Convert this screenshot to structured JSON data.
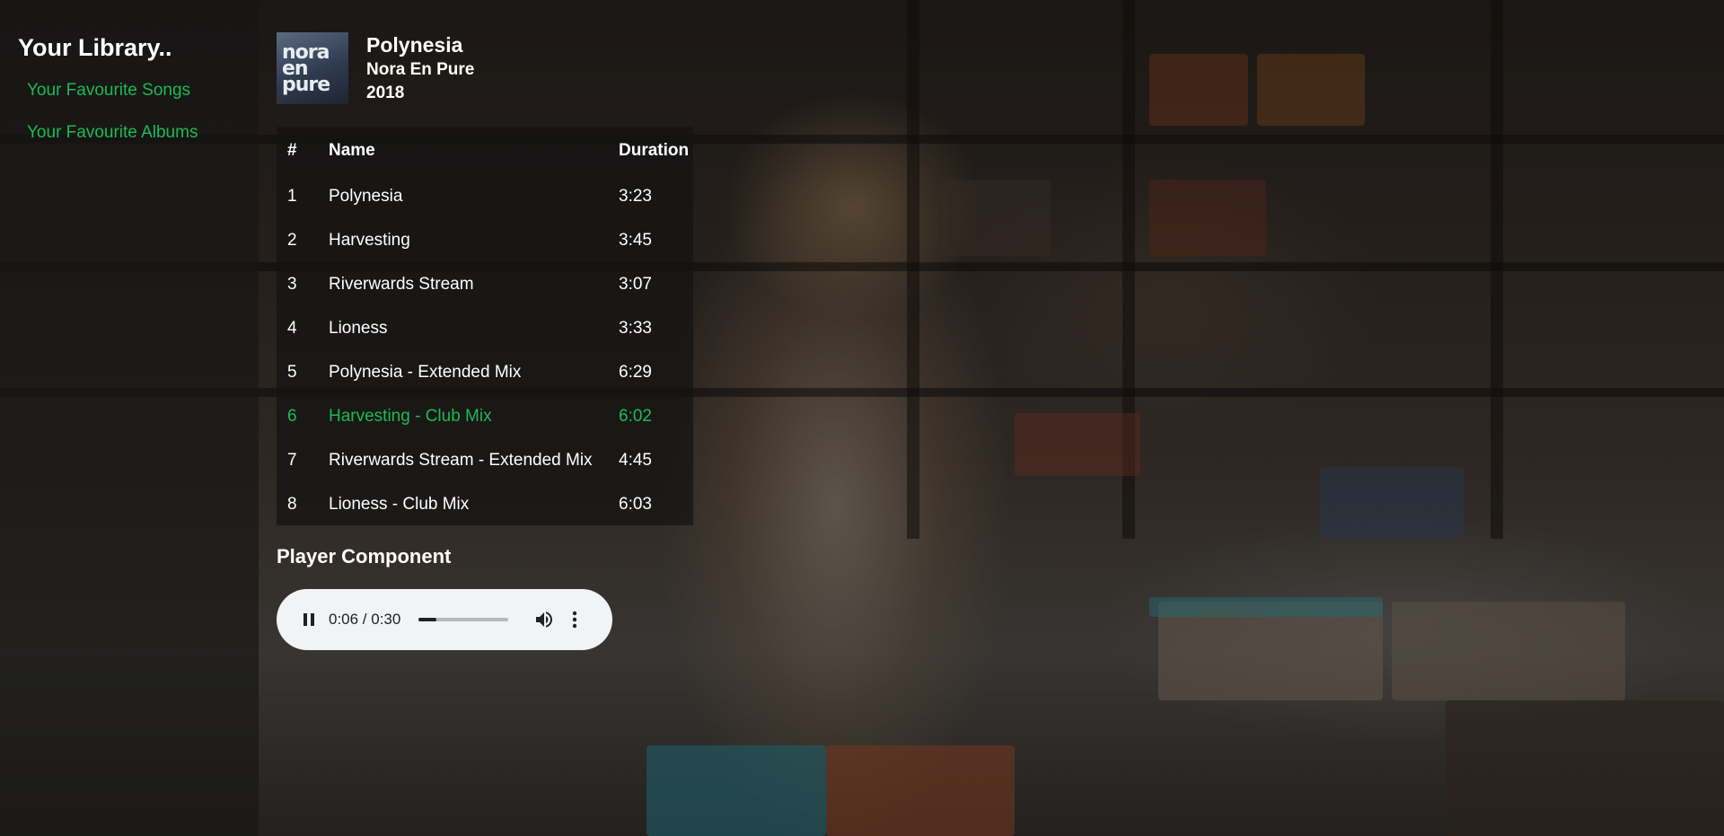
{
  "sidebar": {
    "title": "Your Library..",
    "links": [
      {
        "label": "Your Favourite Songs"
      },
      {
        "label": "Your Favourite Albums"
      }
    ]
  },
  "album": {
    "cover_text": "nora en pure",
    "title": "Polynesia",
    "artist": "Nora En Pure",
    "year": "2018"
  },
  "tracklist": {
    "headers": {
      "num": "#",
      "name": "Name",
      "duration": "Duration"
    },
    "tracks": [
      {
        "num": "1",
        "name": "Polynesia",
        "duration": "3:23",
        "active": false
      },
      {
        "num": "2",
        "name": "Harvesting",
        "duration": "3:45",
        "active": false
      },
      {
        "num": "3",
        "name": "Riverwards Stream",
        "duration": "3:07",
        "active": false
      },
      {
        "num": "4",
        "name": "Lioness",
        "duration": "3:33",
        "active": false
      },
      {
        "num": "5",
        "name": "Polynesia - Extended Mix",
        "duration": "6:29",
        "active": false
      },
      {
        "num": "6",
        "name": "Harvesting - Club Mix",
        "duration": "6:02",
        "active": true
      },
      {
        "num": "7",
        "name": "Riverwards Stream - Extended Mix",
        "duration": "4:45",
        "active": false
      },
      {
        "num": "8",
        "name": "Lioness - Club Mix",
        "duration": "6:03",
        "active": false
      }
    ]
  },
  "player": {
    "title": "Player Component",
    "time": "0:06 / 0:30",
    "progress_fraction": 0.2,
    "icons": {
      "play_pause": "pause-icon",
      "volume": "volume-icon",
      "more": "more-vert-icon"
    }
  },
  "colors": {
    "accent": "#1db954",
    "player_bg": "#f1f3f4",
    "sidebar_bg": "#121212"
  }
}
